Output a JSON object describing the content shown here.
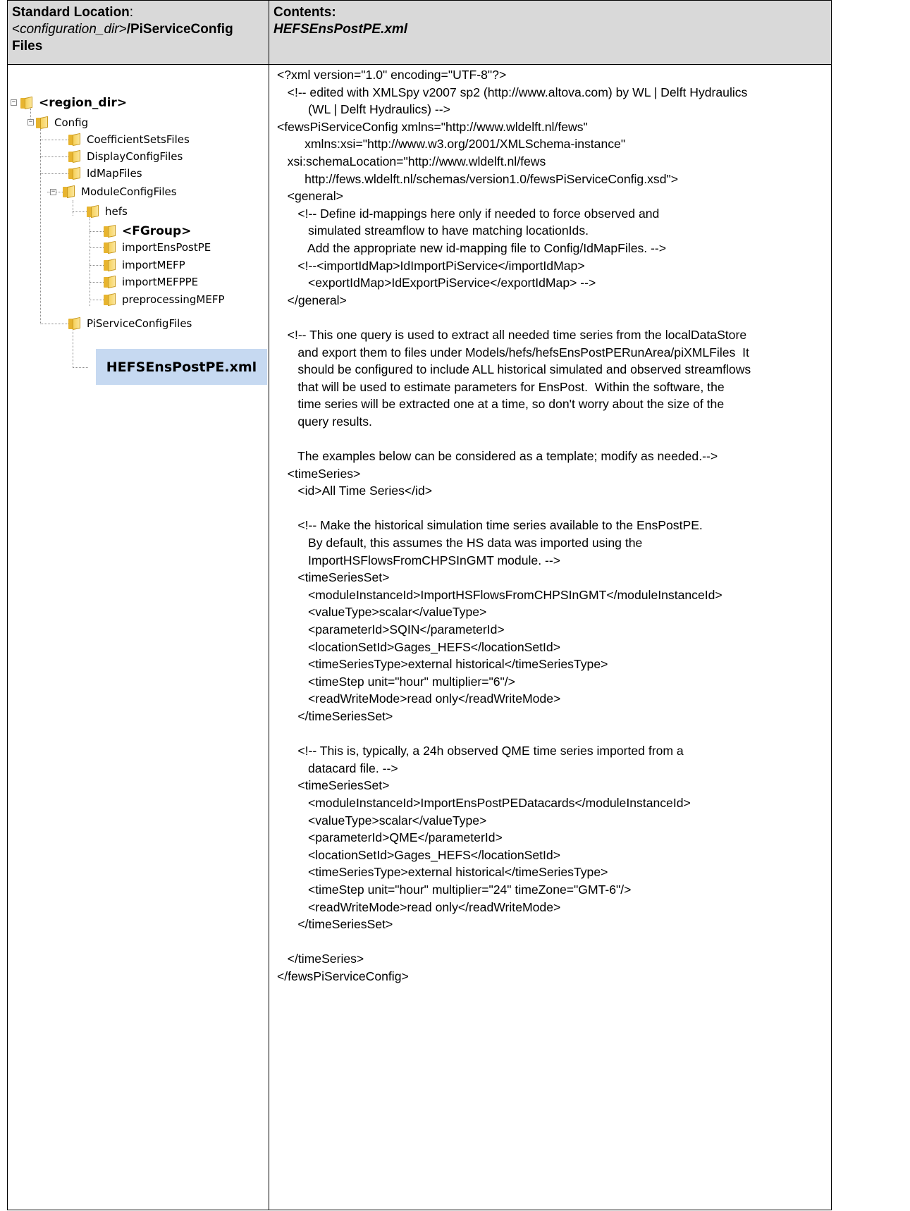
{
  "header": {
    "left": {
      "bold_label": "Standard Location",
      "colon": ":",
      "lt": "<",
      "dir_italic": "configuration_dir",
      "gt": ">",
      "path_bold": "/PiServiceConfig",
      "path_bold2": "Files"
    },
    "right": {
      "label": "Contents:",
      "filename": "HEFSEnsPostPE.xml"
    }
  },
  "tree": {
    "root": "<region_dir>",
    "config": "Config",
    "coefficient": "CoefficientSetsFiles",
    "display": "DisplayConfigFiles",
    "idmap": "IdMapFiles",
    "module": "ModuleConfigFiles",
    "hefs": "hefs",
    "fgroup": "<FGroup>",
    "import_ens": "importEnsPostPE",
    "import_mefp": "importMEFP",
    "import_mefppe": "importMEFPPE",
    "preprocessing": "preprocessingMEFP",
    "piservice": "PiServiceConfigFiles",
    "callout": "HEFSEnsPostPE.xml",
    "expander_minus": "−"
  },
  "code_lines": [
    "<?xml version=\"1.0\" encoding=\"UTF-8\"?>",
    "   <!-- edited with XMLSpy v2007 sp2 (http://www.altova.com) by WL | Delft Hydraulics",
    "         (WL | Delft Hydraulics) -->",
    "<fewsPiServiceConfig xmlns=\"http://www.wldelft.nl/fews\"",
    "        xmlns:xsi=\"http://www.w3.org/2001/XMLSchema-instance\"",
    "   xsi:schemaLocation=\"http://www.wldelft.nl/fews",
    "        http://fews.wldelft.nl/schemas/version1.0/fewsPiServiceConfig.xsd\">",
    "   <general>",
    "      <!-- Define id-mappings here only if needed to force observed and",
    "         simulated streamflow to have matching locationIds.",
    "         Add the appropriate new id-mapping file to Config/IdMapFiles. -->",
    "      <!--<importIdMap>IdImportPiService</importIdMap>",
    "         <exportIdMap>IdExportPiService</exportIdMap> -->",
    "   </general>",
    "",
    "   <!-- This one query is used to extract all needed time series from the localDataStore",
    "      and export them to files under Models/hefs/hefsEnsPostPERunArea/piXMLFiles  It",
    "      should be configured to include ALL historical simulated and observed streamflows",
    "      that will be used to estimate parameters for EnsPost.  Within the software, the",
    "      time series will be extracted one at a time, so don't worry about the size of the",
    "      query results.",
    "",
    "      The examples below can be considered as a template; modify as needed.-->",
    "   <timeSeries>",
    "      <id>All Time Series</id>",
    "",
    "      <!-- Make the historical simulation time series available to the EnsPostPE.",
    "         By default, this assumes the HS data was imported using the",
    "         ImportHSFlowsFromCHPSInGMT module. -->",
    "      <timeSeriesSet>",
    "         <moduleInstanceId>ImportHSFlowsFromCHPSInGMT</moduleInstanceId>",
    "         <valueType>scalar</valueType>",
    "         <parameterId>SQIN</parameterId>",
    "         <locationSetId>Gages_HEFS</locationSetId>",
    "         <timeSeriesType>external historical</timeSeriesType>",
    "         <timeStep unit=\"hour\" multiplier=\"6\"/>",
    "         <readWriteMode>read only</readWriteMode>",
    "      </timeSeriesSet>",
    "",
    "      <!-- This is, typically, a 24h observed QME time series imported from a",
    "         datacard file. -->",
    "      <timeSeriesSet>",
    "         <moduleInstanceId>ImportEnsPostPEDatacards</moduleInstanceId>",
    "         <valueType>scalar</valueType>",
    "         <parameterId>QME</parameterId>",
    "         <locationSetId>Gages_HEFS</locationSetId>",
    "         <timeSeriesType>external historical</timeSeriesType>",
    "         <timeStep unit=\"hour\" multiplier=\"24\" timeZone=\"GMT-6\"/>",
    "         <readWriteMode>read only</readWriteMode>",
    "      </timeSeriesSet>",
    "",
    "   </timeSeries>",
    "</fewsPiServiceConfig>"
  ]
}
